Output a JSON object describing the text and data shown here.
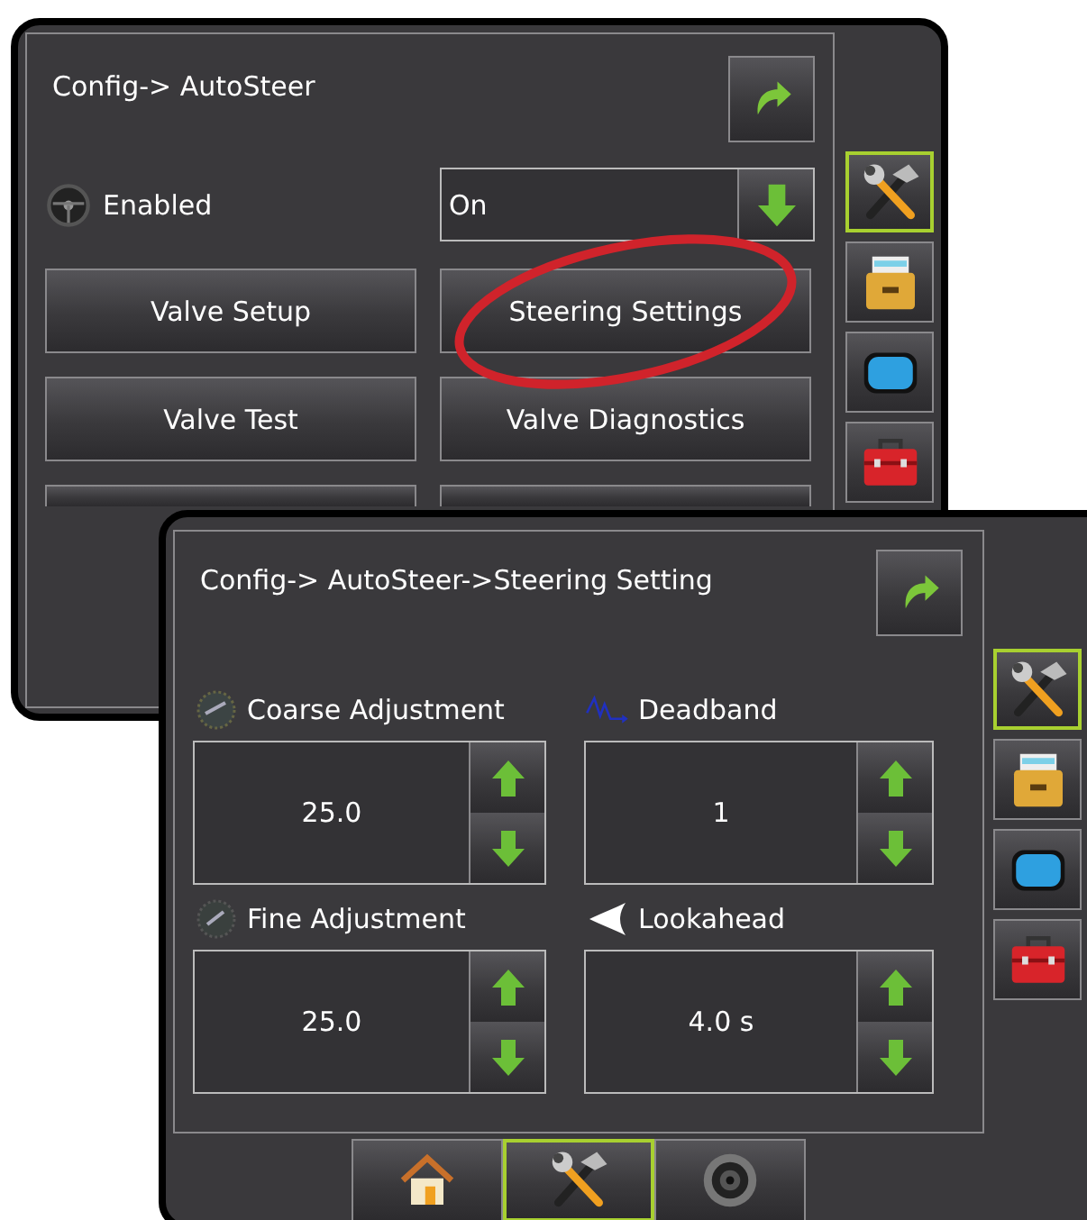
{
  "back_screen": {
    "title": "Config-> AutoSteer",
    "enabled": {
      "label": "Enabled",
      "value": "On"
    },
    "buttons": [
      {
        "label": "Valve Setup"
      },
      {
        "label": "Steering Settings"
      },
      {
        "label": "Valve Test"
      },
      {
        "label": "Valve Diagnostics"
      }
    ],
    "side_tabs": [
      {
        "kind": "tools",
        "selected": true
      },
      {
        "kind": "files",
        "selected": false
      },
      {
        "kind": "display",
        "selected": false
      },
      {
        "kind": "toolbox",
        "selected": false
      }
    ]
  },
  "front_screen": {
    "title": "Config-> AutoSteer->Steering Setting",
    "settings": [
      {
        "kind": "coarse",
        "label": "Coarse Adjustment",
        "value": "25.0"
      },
      {
        "kind": "deadband",
        "label": "Deadband",
        "value": "1"
      },
      {
        "kind": "fine",
        "label": "Fine Adjustment",
        "value": "25.0"
      },
      {
        "kind": "lookahead",
        "label": "Lookahead",
        "value": "4.0 s"
      }
    ],
    "side_tabs": [
      {
        "kind": "tools",
        "selected": true
      },
      {
        "kind": "files",
        "selected": false
      },
      {
        "kind": "display",
        "selected": false
      },
      {
        "kind": "toolbox",
        "selected": false
      }
    ],
    "bottom_tabs": [
      {
        "kind": "home",
        "selected": false
      },
      {
        "kind": "tools",
        "selected": true
      },
      {
        "kind": "camera",
        "selected": false
      }
    ]
  }
}
